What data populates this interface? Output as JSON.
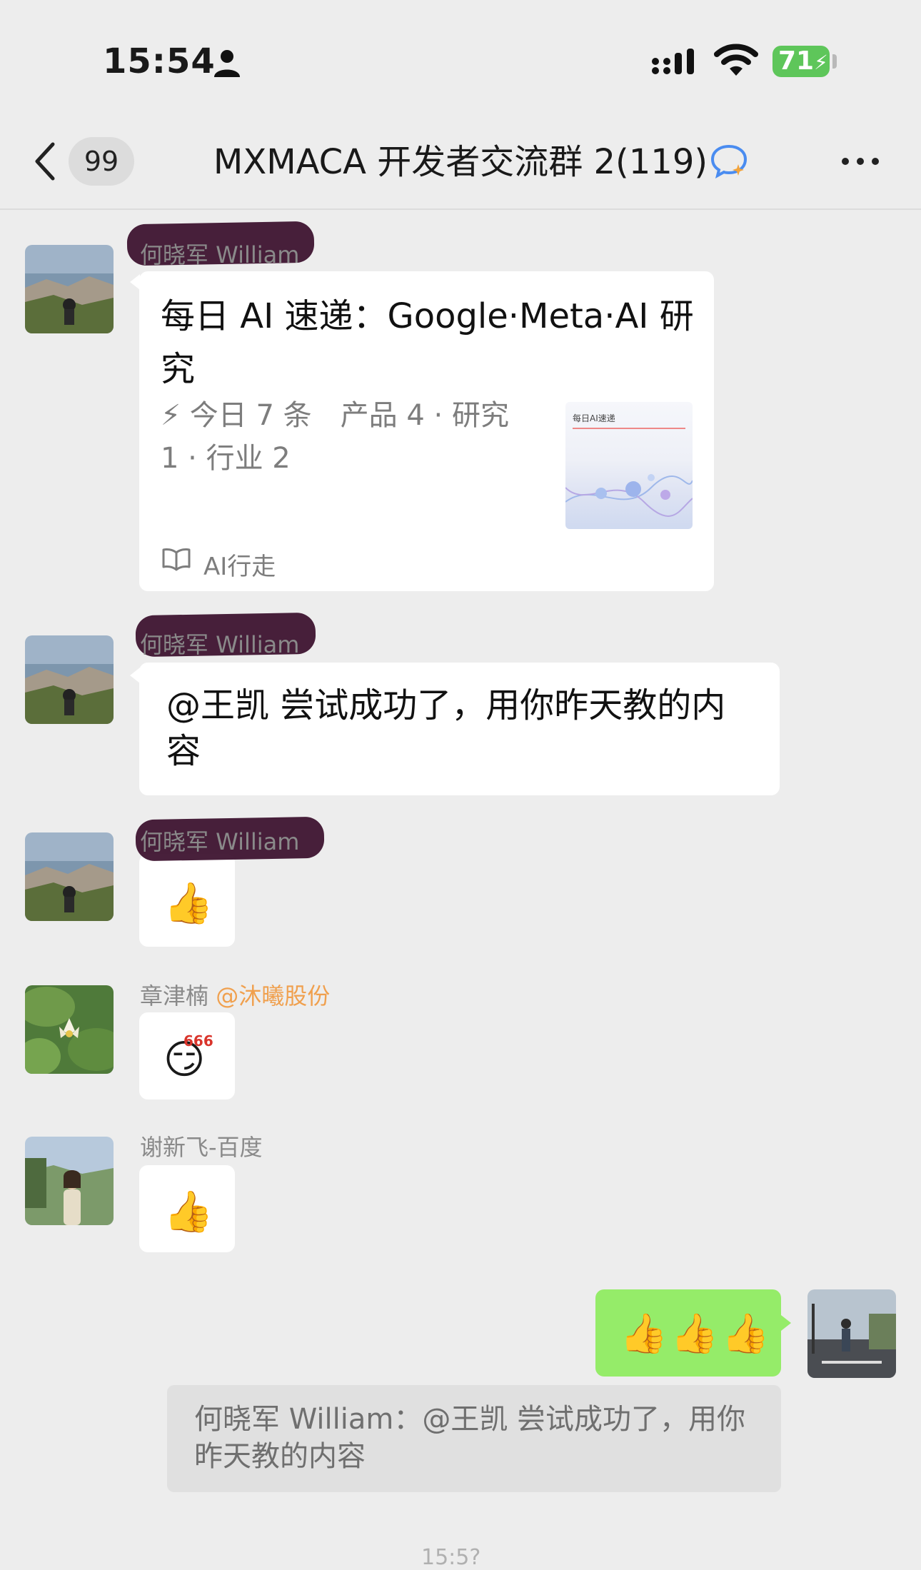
{
  "status_bar": {
    "time": "15:54",
    "battery": "71"
  },
  "nav": {
    "unread_count": "99",
    "title": "MXMACA 开发者交流群 2(119)"
  },
  "messages": [
    {
      "sender": "何晓军 William",
      "type": "article",
      "title": "每日 AI 速递：Google·Meta·AI 研究",
      "desc_line1": "⚡ 今日 7 条　产品 4 · 研究",
      "desc_line2": "1 · 行业 2",
      "thumb_title": "每日AI速递",
      "source": "AI行走"
    },
    {
      "sender": "何晓军 William",
      "type": "text",
      "line1": "@王凯 尝试成功了，用你昨天教的内",
      "line2": "容"
    },
    {
      "sender": "何晓军 William",
      "type": "sticker",
      "emoji": "👍"
    },
    {
      "sender": "章津楠",
      "org": "@沐曦股份",
      "type": "sticker",
      "emoji": "😏",
      "badge": "666"
    },
    {
      "sender": "谢新飞-百度",
      "type": "sticker",
      "emoji": "👍"
    }
  ],
  "outgoing": {
    "text": "👍👍👍",
    "quote_line1": "何晓军 William：@王凯 尝试成功了，用你",
    "quote_line2": "昨天教的内容"
  },
  "timestamp_partial": "15:5?"
}
